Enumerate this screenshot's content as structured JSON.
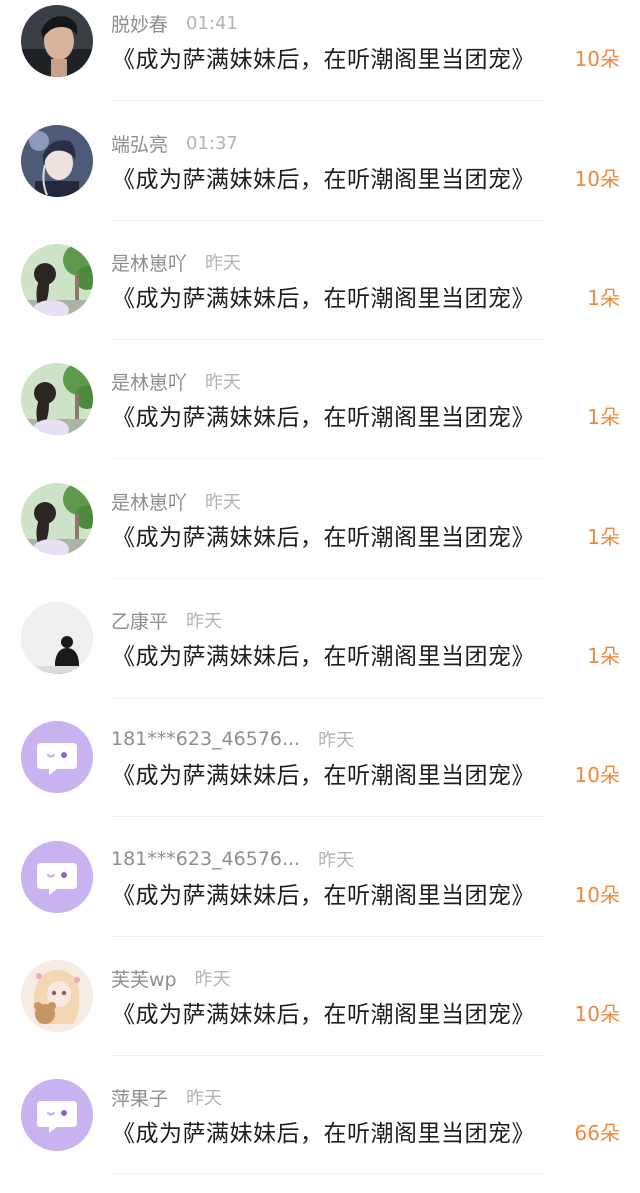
{
  "messages": [
    {
      "name": "脱妙春",
      "time": "01:41",
      "text": "《成为萨满妹妹后，在听潮阁里当团宠》",
      "count": "10朵",
      "avatar": "portrait-man-dark-hair"
    },
    {
      "name": "端弘亮",
      "time": "01:37",
      "text": "《成为萨满妹妹后，在听潮阁里当团宠》",
      "count": "10朵",
      "avatar": "anime-boy-headphones"
    },
    {
      "name": "是林崽吖",
      "time": "昨天",
      "text": "《成为萨满妹妹后，在听潮阁里当团宠》",
      "count": "1朵",
      "avatar": "girl-ponytail-trees"
    },
    {
      "name": "是林崽吖",
      "time": "昨天",
      "text": "《成为萨满妹妹后，在听潮阁里当团宠》",
      "count": "1朵",
      "avatar": "girl-ponytail-trees"
    },
    {
      "name": "是林崽吖",
      "time": "昨天",
      "text": "《成为萨满妹妹后，在听潮阁里当团宠》",
      "count": "1朵",
      "avatar": "girl-ponytail-trees"
    },
    {
      "name": "乙康平",
      "time": "昨天",
      "text": "《成为萨满妹妹后，在听潮阁里当团宠》",
      "count": "1朵",
      "avatar": "bw-figure-silhouette"
    },
    {
      "name": "181***623_46576...",
      "time": "昨天",
      "text": "《成为萨满妹妹后，在听潮阁里当团宠》",
      "count": "10朵",
      "avatar": "default-chat-bubble"
    },
    {
      "name": "181***623_46576...",
      "time": "昨天",
      "text": "《成为萨满妹妹后，在听潮阁里当团宠》",
      "count": "10朵",
      "avatar": "default-chat-bubble"
    },
    {
      "name": "芙芙wp",
      "time": "昨天",
      "text": "《成为萨满妹妹后，在听潮阁里当团宠》",
      "count": "10朵",
      "avatar": "anime-girl-teddy-bear"
    },
    {
      "name": "萍果子",
      "time": "昨天",
      "text": "《成为萨满妹妹后，在听潮阁里当团宠》",
      "count": "66朵",
      "avatar": "default-chat-bubble"
    }
  ],
  "colors": {
    "name": "#8e8e8e",
    "time": "#b3b3b3",
    "text": "#1f1f1f",
    "count": "#ef8a3c",
    "default_avatar": "#c8b2ef"
  }
}
